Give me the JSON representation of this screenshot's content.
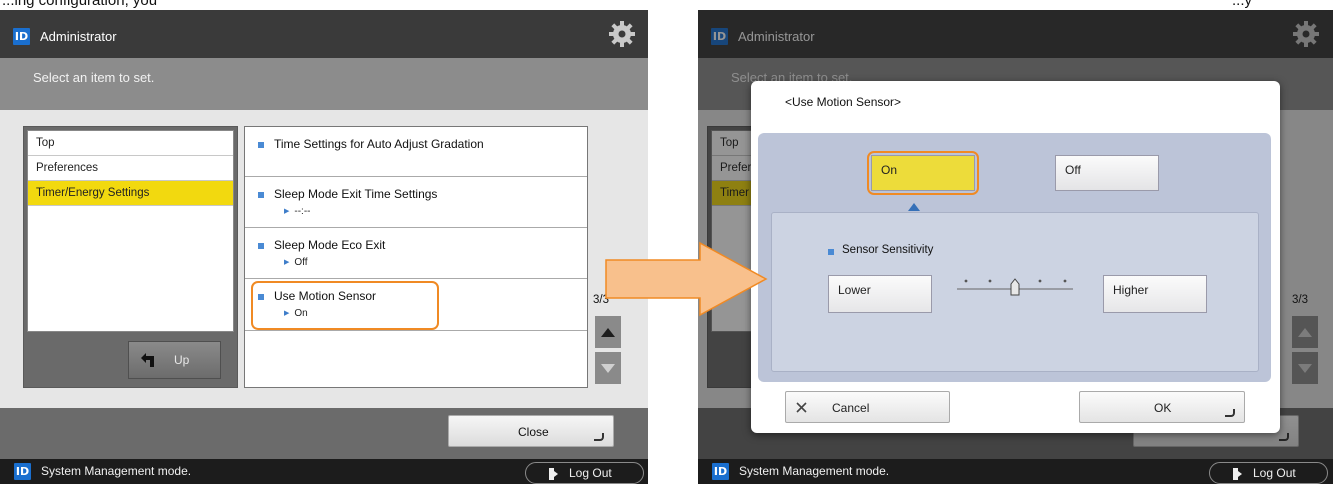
{
  "caption": {
    "left_fragment": "...ing configuration, you",
    "right_fragment": "...y"
  },
  "colors": {
    "selection": "#f2d90f",
    "highlight_outline": "#f08a24",
    "arrow_fill": "#f8c08c",
    "id_logo": "#1a6fcf"
  },
  "screen_a": {
    "header": {
      "logo": "ID",
      "user": "Administrator",
      "gear_icon": "gear-icon"
    },
    "instruction": "Select an item to set.",
    "tree": {
      "items": [
        "Top",
        "Preferences",
        "Timer/Energy Settings"
      ],
      "selected_index": 2
    },
    "up_button": "Up",
    "settings": [
      {
        "title": "Time Settings for Auto Adjust Gradation",
        "value": ""
      },
      {
        "title": "Sleep Mode Exit Time Settings",
        "value": "--:--"
      },
      {
        "title": "Sleep Mode Eco Exit",
        "value": "Off"
      },
      {
        "title": "Use Motion Sensor",
        "value": "On"
      }
    ],
    "highlighted_setting": "Use Motion Sensor",
    "page": "3/3",
    "close_button": "Close",
    "status": {
      "logo": "ID",
      "text": "System Management mode.",
      "logout": "Log Out"
    }
  },
  "screen_b": {
    "header": {
      "logo": "ID",
      "user": "Administrator",
      "gear_icon": "gear-icon"
    },
    "instruction": "Select an item to set.",
    "tree_items_partial": [
      "Top",
      "Prefer",
      "Timer"
    ],
    "page": "3/3",
    "dialog": {
      "title": "<Use Motion Sensor>",
      "options": [
        "On",
        "Off"
      ],
      "selected_option": "On",
      "sensitivity_label": "Sensor Sensitivity",
      "lower_button": "Lower",
      "higher_button": "Higher",
      "slider": {
        "levels": 5,
        "selected_level": 3
      },
      "cancel_button": "Cancel",
      "ok_button": "OK"
    },
    "status": {
      "logo": "ID",
      "text": "System Management mode.",
      "logout": "Log Out"
    }
  }
}
